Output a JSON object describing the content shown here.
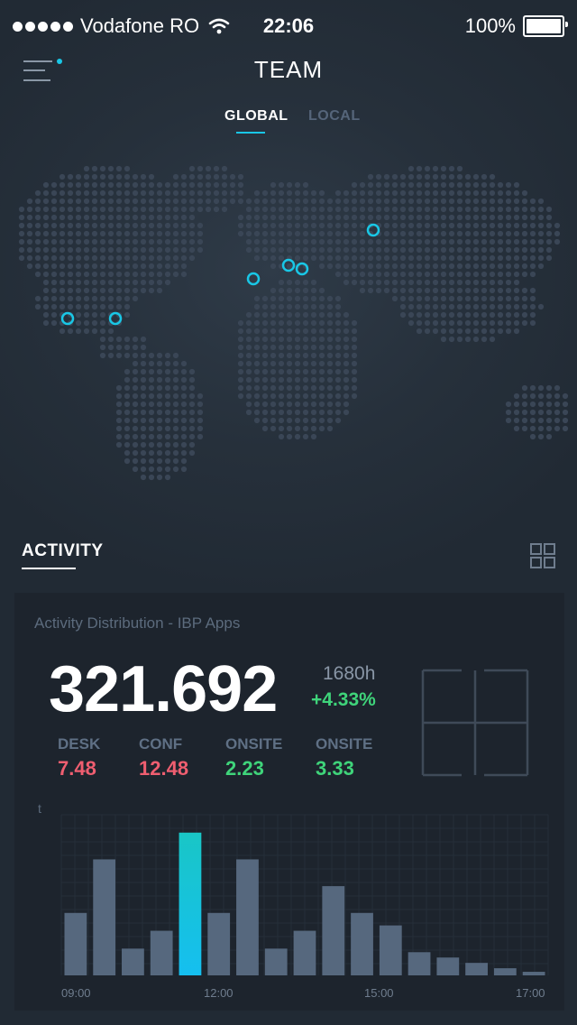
{
  "status_bar": {
    "carrier": "Vodafone RO",
    "time": "22:06",
    "battery": "100%",
    "battery_level": 1.0
  },
  "header": {
    "title": "TEAM",
    "tabs": [
      {
        "label": "GLOBAL",
        "active": true
      },
      {
        "label": "LOCAL",
        "active": false
      }
    ],
    "menu_icon": "hamburger-menu-icon",
    "notification_dot_color": "#19c7e6"
  },
  "map": {
    "markers_count": 6,
    "marker_color": "#19c7e6"
  },
  "activity": {
    "section_title": "ACTIVITY",
    "view_icon": "grid-view-icon",
    "card": {
      "title": "Activity Distribution - IBP Apps",
      "total": "321.692",
      "hours": "1680h",
      "change": "+4.33%",
      "metrics": [
        {
          "label": "DESK",
          "value": "7.48",
          "color": "#ef5e70"
        },
        {
          "label": "CONF",
          "value": "12.48",
          "color": "#ef5e70"
        },
        {
          "label": "ONSITE",
          "value": "2.23",
          "color": "#3fd47a"
        },
        {
          "label": "ONSITE",
          "value": "3.33",
          "color": "#3fd47a"
        }
      ]
    }
  },
  "chart_data": {
    "type": "bar",
    "ylabel": "t",
    "xlabel": "",
    "x_ticks": [
      "09:00",
      "12:00",
      "15:00",
      "17:00"
    ],
    "values": [
      35,
      65,
      15,
      25,
      80,
      35,
      65,
      15,
      25,
      50,
      35,
      28,
      13,
      10,
      7,
      4,
      2
    ],
    "highlight_index": 4,
    "bar_color": "#56687e",
    "highlight_gradient": [
      "#19c6c6",
      "#15bff0"
    ],
    "ylim": [
      0,
      90
    ],
    "grid": true
  }
}
